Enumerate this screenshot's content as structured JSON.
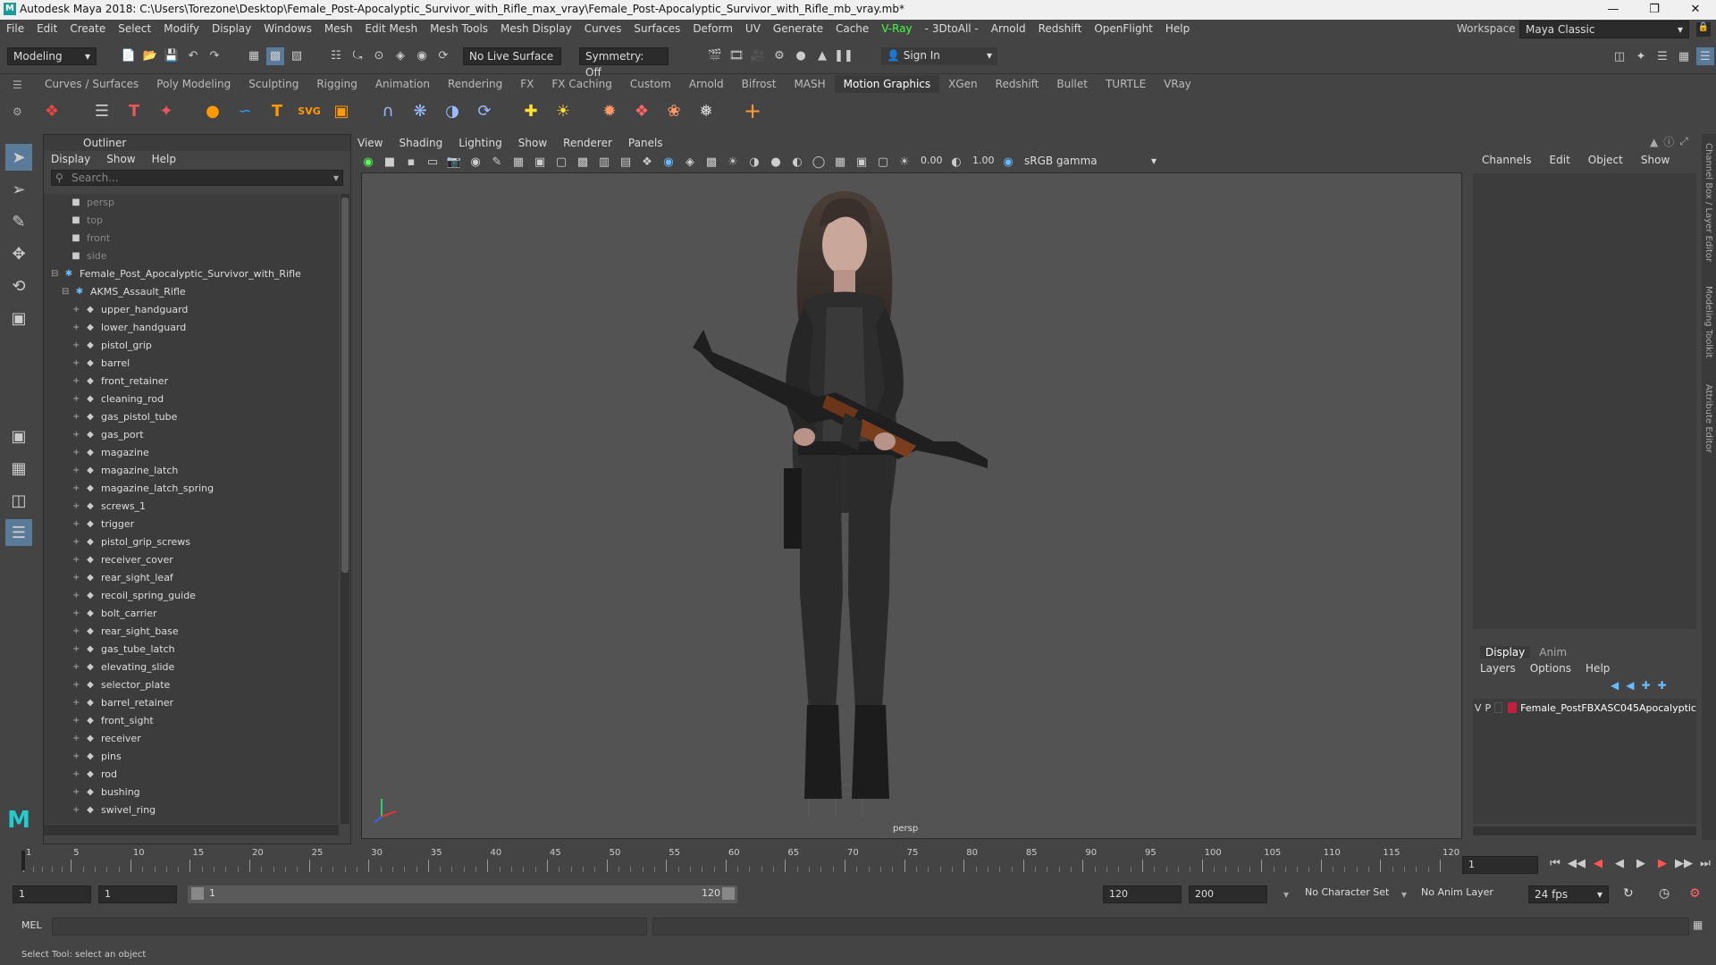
{
  "window": {
    "title": "Autodesk Maya 2018: C:\\Users\\Torezone\\Desktop\\Female_Post-Apocalyptic_Survivor_with_Rifle_max_vray\\Female_Post-Apocalyptic_Survivor_with_Rifle_mb_vray.mb*"
  },
  "menubar": {
    "items": [
      "File",
      "Edit",
      "Create",
      "Select",
      "Modify",
      "Display",
      "Windows",
      "Mesh",
      "Edit Mesh",
      "Mesh Tools",
      "Mesh Display",
      "Curves",
      "Surfaces",
      "Deform",
      "UV",
      "Generate",
      "Cache",
      "V-Ray",
      "- 3DtoAll -",
      "Arnold",
      "Redshift",
      "OpenFlight",
      "Help"
    ],
    "workspace_label": "Workspace :",
    "workspace_value": "Maya Classic"
  },
  "statusline": {
    "mode": "Modeling",
    "live_surface": "No Live Surface",
    "symmetry": "Symmetry: Off",
    "sign_in": "Sign In"
  },
  "shelf": {
    "tabs": [
      "Curves / Surfaces",
      "Poly Modeling",
      "Sculpting",
      "Rigging",
      "Animation",
      "Rendering",
      "FX",
      "FX Caching",
      "Custom",
      "Arnold",
      "Bifrost",
      "MASH",
      "Motion Graphics",
      "XGen",
      "Redshift",
      "Bullet",
      "TURTLE",
      "VRay"
    ],
    "active_tab": "Motion Graphics"
  },
  "outliner": {
    "title": "Outliner",
    "menu": [
      "Display",
      "Show",
      "Help"
    ],
    "search_placeholder": "Search...",
    "cameras": [
      "persp",
      "top",
      "front",
      "side"
    ],
    "root": "Female_Post_Apocalyptic_Survivor_with_Rifle",
    "group": "AKMS_Assault_Rifle",
    "children": [
      "upper_handguard",
      "lower_handguard",
      "pistol_grip",
      "barrel",
      "front_retainer",
      "cleaning_rod",
      "gas_pistol_tube",
      "gas_port",
      "magazine",
      "magazine_latch",
      "magazine_latch_spring",
      "screws_1",
      "trigger",
      "pistol_grip_screws",
      "receiver_cover",
      "rear_sight_leaf",
      "recoil_spring_guide",
      "bolt_carrier",
      "rear_sight_base",
      "gas_tube_latch",
      "elevating_slide",
      "selector_plate",
      "barrel_retainer",
      "front_sight",
      "receiver",
      "pins",
      "rod",
      "bushing",
      "swivel_ring"
    ]
  },
  "viewport": {
    "menu": [
      "View",
      "Shading",
      "Lighting",
      "Show",
      "Renderer",
      "Panels"
    ],
    "exposure": "0.00",
    "gamma": "1.00",
    "color_space": "sRGB gamma",
    "camera_label": "persp"
  },
  "channelbox": {
    "menu": [
      "Channels",
      "Edit",
      "Object",
      "Show"
    ]
  },
  "layereditor": {
    "tabs": [
      "Display",
      "Anim"
    ],
    "menu": [
      "Layers",
      "Options",
      "Help"
    ],
    "layer_v": "V",
    "layer_p": "P",
    "layer_name": "Female_PostFBXASC045Apocalyptic",
    "layer_color": "#c0203a"
  },
  "sidetabs": [
    "Channel Box / Layer Editor",
    "Modeling Toolkit",
    "Attribute Editor"
  ],
  "timeline": {
    "ticks": [
      "1",
      "5",
      "10",
      "15",
      "20",
      "25",
      "30",
      "35",
      "40",
      "45",
      "50",
      "55",
      "60",
      "65",
      "70",
      "75",
      "80",
      "85",
      "90",
      "95",
      "100",
      "105",
      "110",
      "115",
      "120"
    ],
    "current_frame": "1"
  },
  "range": {
    "start": "1",
    "anim_start": "1",
    "slider_start": "1",
    "slider_end": "120",
    "end": "120",
    "anim_end": "200",
    "character_set": "No Character Set",
    "anim_layer": "No Anim Layer",
    "fps": "24 fps"
  },
  "command": {
    "label": "MEL"
  },
  "helpline": {
    "text": "Select Tool: select an object"
  }
}
